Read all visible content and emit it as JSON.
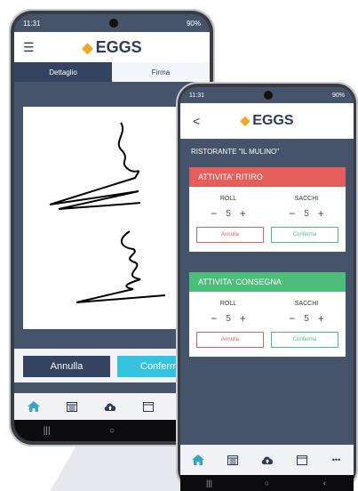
{
  "colors": {
    "navy": "#334360",
    "accent_blue": "#35c2e0",
    "red": "#e45e5c",
    "green": "#4bbf7a",
    "egg": "#f5a623"
  },
  "back_phone": {
    "status": {
      "time": "11:31",
      "signal": "90%"
    },
    "brand": "EGGS",
    "tabs": [
      {
        "label": "Dettaglio"
      },
      {
        "label": "Firma"
      }
    ],
    "buttons": {
      "cancel": "Annulla",
      "confirm": "Conferm"
    },
    "nav_icons": [
      "home-icon",
      "calendar-icon",
      "cloud-upload-icon",
      "calendar-outline-icon",
      "more-icon"
    ],
    "system_nav": {
      "recent": "|||",
      "home": "○",
      "back": "‹"
    }
  },
  "front_phone": {
    "status": {
      "time": "11:31",
      "signal": "90%"
    },
    "brand": "EGGS",
    "back_glyph": "<",
    "restaurant": "RISTORANTE \"IL MULINO\"",
    "cards": [
      {
        "title": "ATTIVITA' RITIRO",
        "color": "red",
        "columns": [
          {
            "label": "ROLL",
            "value": "5"
          },
          {
            "label": "SACCHI",
            "value": "5"
          }
        ],
        "cancel": "Annulla",
        "confirm": "Conferma"
      },
      {
        "title": "ATTIVITA' CONSEGNA",
        "color": "green",
        "columns": [
          {
            "label": "ROLL",
            "value": "5"
          },
          {
            "label": "SACCHI",
            "value": "5"
          }
        ],
        "cancel": "Annulla",
        "confirm": "Conferma"
      }
    ],
    "nav_icons": [
      "home-icon",
      "calendar-icon",
      "cloud-upload-icon",
      "calendar-outline-icon",
      "more-icon"
    ],
    "more_glyph": "•••",
    "system_nav": {
      "recent": "|||",
      "home": "○",
      "back": "‹"
    }
  },
  "stepper": {
    "minus": "−",
    "plus": "+"
  }
}
